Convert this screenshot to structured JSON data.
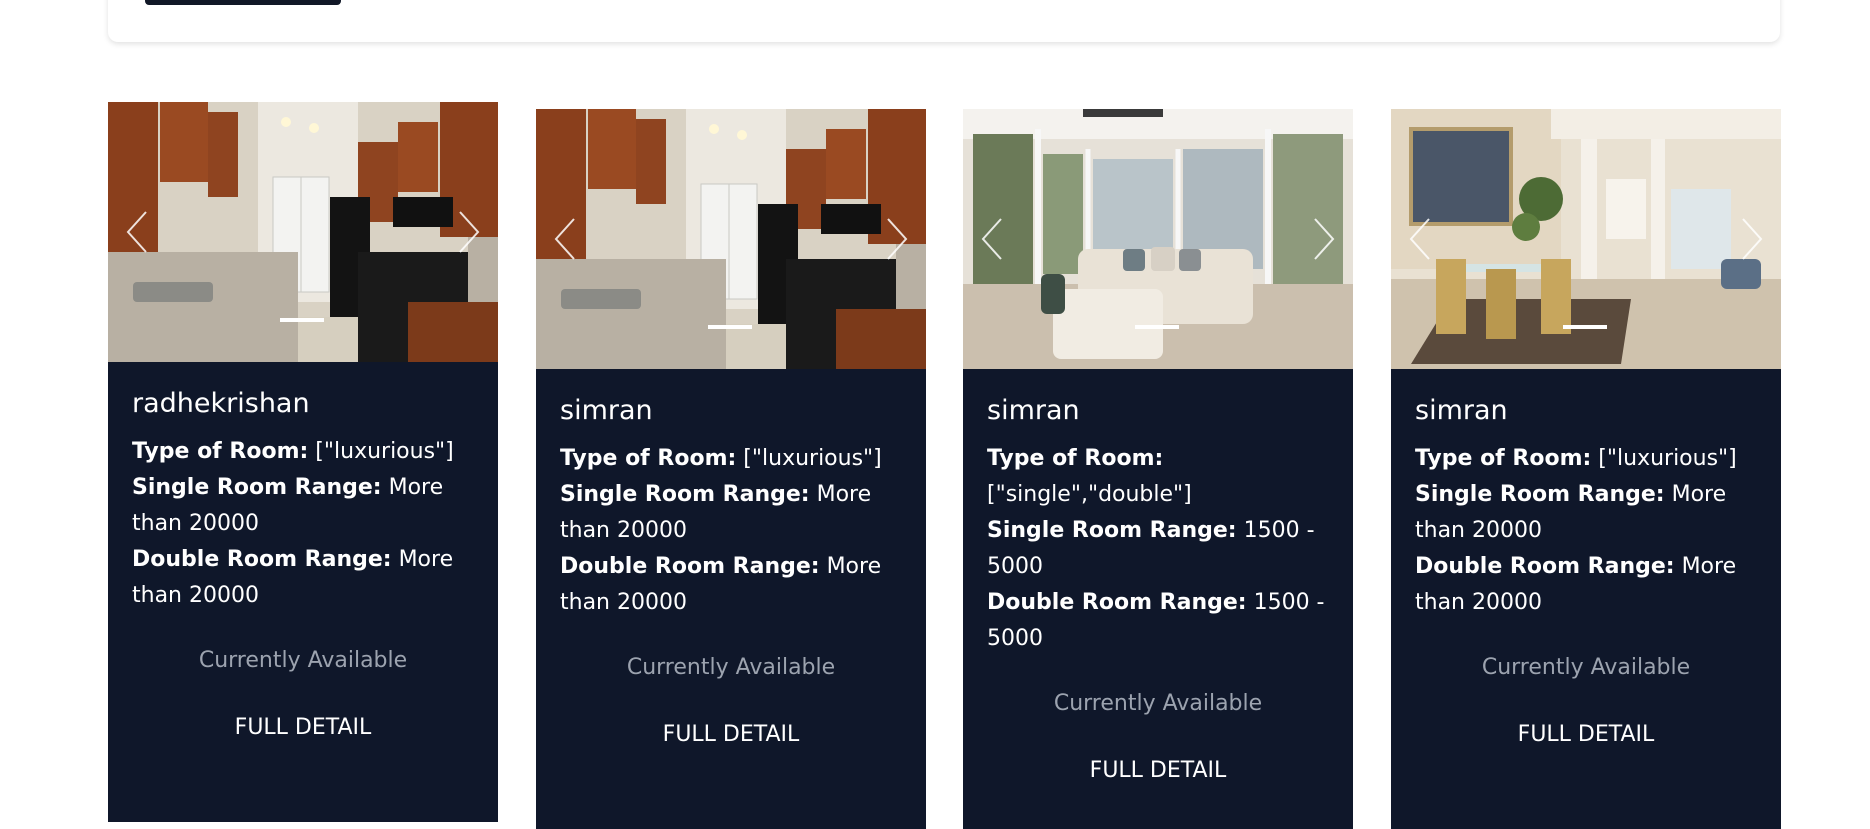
{
  "cards": [
    {
      "owner": "radhekrishan",
      "type_label": "Type of Room:",
      "type_value": " [\"luxurious\"]",
      "single_label": "Single Room Range:",
      "single_value": " More than 20000",
      "double_label": "Double Room Range:",
      "double_value": " More than 20000",
      "availability": "Currently Available",
      "detail_link": "FULL DETAIL",
      "photo": "kitchen"
    },
    {
      "owner": "simran",
      "type_label": "Type of Room:",
      "type_value": " [\"luxurious\"]",
      "single_label": "Single Room Range:",
      "single_value": " More than 20000",
      "double_label": "Double Room Range:",
      "double_value": " More than 20000",
      "availability": "Currently Available",
      "detail_link": "FULL DETAIL",
      "photo": "kitchen"
    },
    {
      "owner": "simran",
      "type_label": "Type of Room:",
      "type_value": " [\"single\",\"double\"]",
      "single_label": "Single Room Range:",
      "single_value": " 1500 - 5000",
      "double_label": "Double Room Range:",
      "double_value": " 1500 - 5000",
      "availability": "Currently Available",
      "detail_link": "FULL DETAIL",
      "photo": "sunroom"
    },
    {
      "owner": "simran",
      "type_label": "Type of Room:",
      "type_value": " [\"luxurious\"]",
      "single_label": "Single Room Range:",
      "single_value": " More than 20000",
      "double_label": "Double Room Range:",
      "double_value": " More than 20000",
      "availability": "Currently Available",
      "detail_link": "FULL DETAIL",
      "photo": "dining"
    }
  ],
  "icons": {
    "prev": "chevron-left-icon",
    "next": "chevron-right-icon"
  },
  "colors": {
    "card_background": "#0f172a",
    "availability_text": "#9ca3af"
  }
}
